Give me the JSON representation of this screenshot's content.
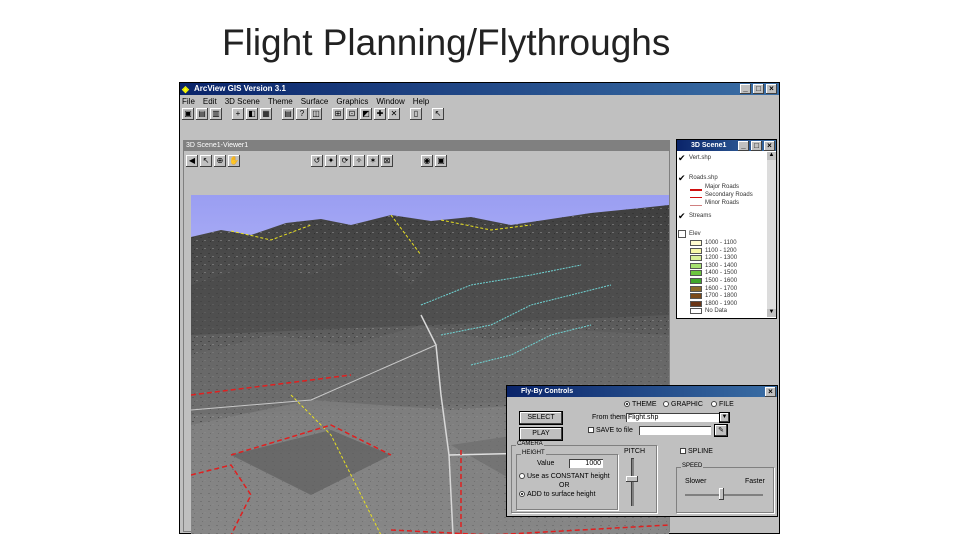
{
  "slide": {
    "title": "Flight Planning/Flythroughs"
  },
  "app": {
    "title": "ArcView GIS Version 3.1",
    "menu": [
      "File",
      "Edit",
      "3D Scene",
      "Theme",
      "Surface",
      "Graphics",
      "Window",
      "Help"
    ],
    "view_title": "3D Scene1-Viewer1"
  },
  "legend": {
    "title": "3D Scene1",
    "themes": [
      "Vert.shp",
      "Roads.shp",
      "Streams",
      "Elev"
    ],
    "road_classes": [
      "Major Roads",
      "Secondary Roads",
      "Minor Roads"
    ],
    "elev_classes": [
      "1000 - 1100",
      "1100 - 1200",
      "1200 - 1300",
      "1300 - 1400",
      "1400 - 1500",
      "1500 - 1600",
      "1600 - 1700",
      "1700 - 1800",
      "1800 - 1900",
      "No Data"
    ],
    "elev_colors": [
      "#fffcd0",
      "#f6f7a8",
      "#d9f09a",
      "#a6e070",
      "#6cc63f",
      "#3fa62b",
      "#8a6a2a",
      "#7a4a1a",
      "#6a3516",
      "#ffffff"
    ]
  },
  "flyby": {
    "title": "Fly-By Controls",
    "modes": [
      "THEME",
      "GRAPHIC",
      "FILE"
    ],
    "selected_mode": "THEME",
    "buttons": {
      "select": "SELECT",
      "play": "PLAY"
    },
    "from_theme_label": "From theme",
    "from_theme_value": "Flight.shp",
    "save_label": "SAVE to file",
    "camera_group": "CAMERA",
    "height_group": "HEIGHT",
    "value_label": "Value",
    "value": "1000",
    "use_constant_label": "Use as CONSTANT height",
    "or_label": "OR",
    "add_to_surface_label": "ADD to surface height",
    "pitch_label": "PITCH",
    "spline_label": "SPLINE",
    "speed_group": "SPEED",
    "slower_label": "Slower",
    "faster_label": "Faster"
  }
}
